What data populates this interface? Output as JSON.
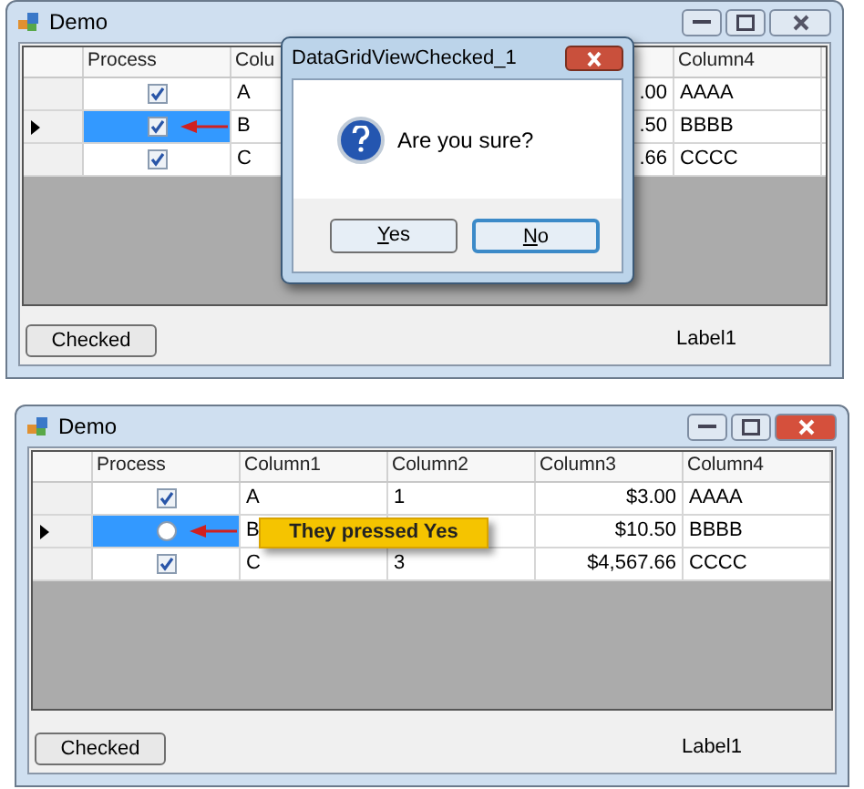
{
  "windows": [
    {
      "title": "Demo",
      "active": false,
      "header": {
        "process": "Process",
        "column1": "Colu",
        "column4": "Column4"
      },
      "rows": [
        {
          "current": false,
          "process_selected": false,
          "checked": true,
          "column1": "A",
          "column3": ".00",
          "column4": "AAAA"
        },
        {
          "current": true,
          "process_selected": true,
          "checked": true,
          "column1": "B",
          "column3": ".50",
          "column4": "BBBB"
        },
        {
          "current": false,
          "process_selected": false,
          "checked": true,
          "column1": "C",
          "column3": ".66",
          "column4": "CCCC"
        }
      ],
      "button": "Checked",
      "label": "Label1",
      "dialog": {
        "title": "DataGridViewChecked_1",
        "message": "Are you sure?",
        "buttons": [
          {
            "label": "Yes",
            "default": false
          },
          {
            "label": "No",
            "default": true
          }
        ]
      }
    },
    {
      "title": "Demo",
      "active": true,
      "header": {
        "process": "Process",
        "column1": "Column1",
        "column2": "Column2",
        "column3": "Column3",
        "column4": "Column4"
      },
      "rows": [
        {
          "current": false,
          "process_selected": false,
          "checked": true,
          "column1": "A",
          "column2": "1",
          "column3": "$3.00",
          "column4": "AAAA"
        },
        {
          "current": true,
          "process_selected": true,
          "checked": false,
          "column1": "B",
          "column3": "$10.50",
          "column4": "BBBB"
        },
        {
          "current": false,
          "process_selected": false,
          "checked": true,
          "column1": "C",
          "column2": "3",
          "column3": "$4,567.66",
          "column4": "CCCC"
        }
      ],
      "button": "Checked",
      "label": "Label1",
      "callout": "They pressed Yes"
    }
  ]
}
